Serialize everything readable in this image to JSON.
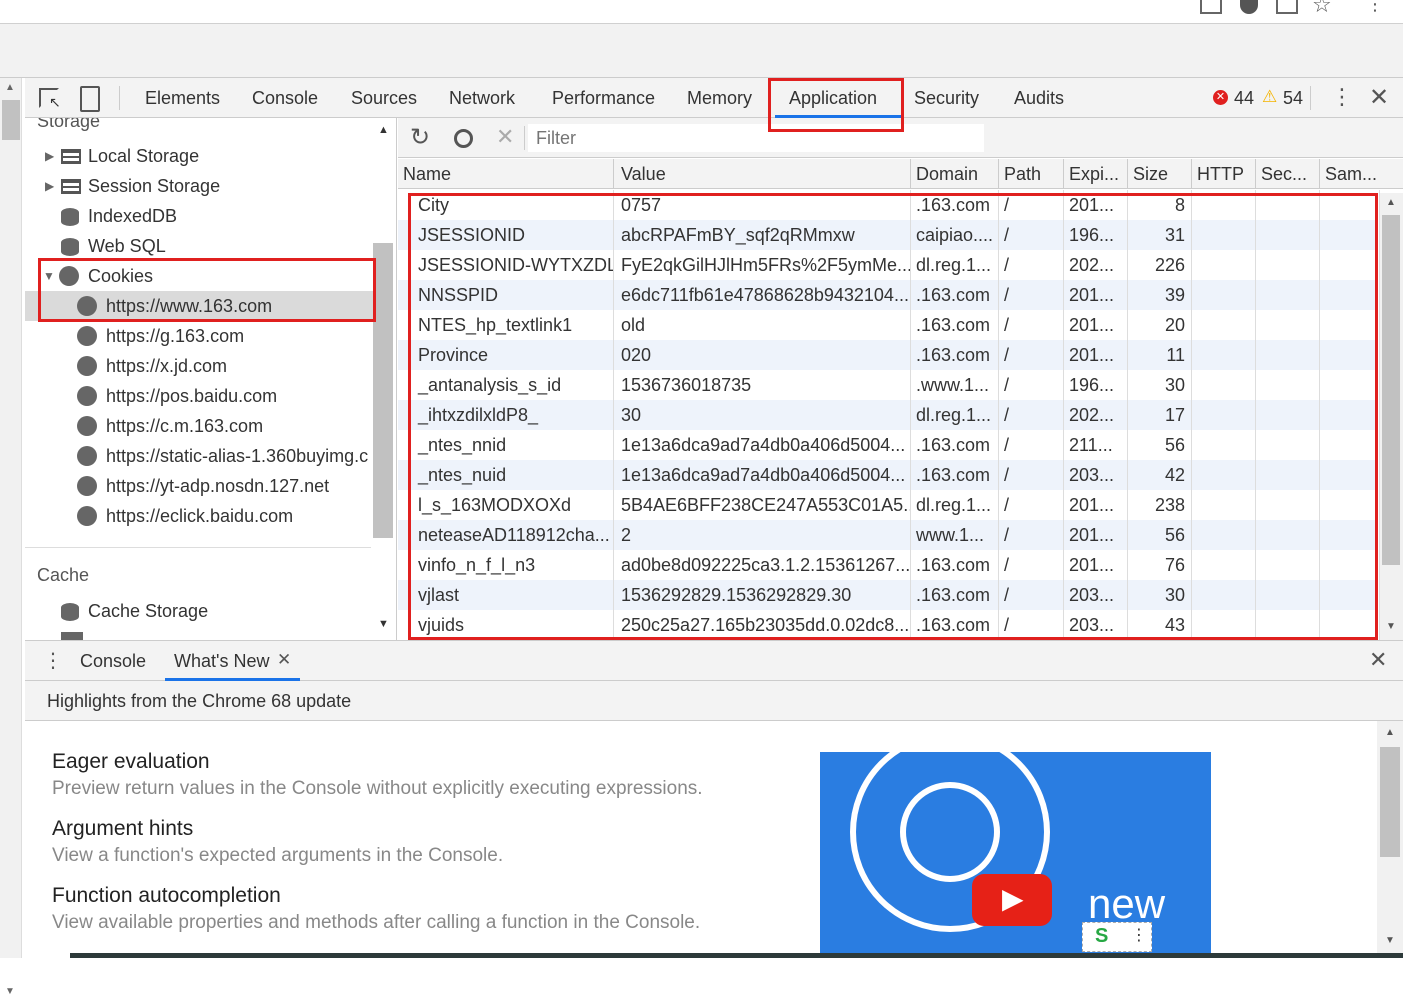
{
  "toolbar": {
    "tabs": [
      "Elements",
      "Console",
      "Sources",
      "Network",
      "Performance",
      "Memory",
      "Application",
      "Security",
      "Audits"
    ],
    "active_tab": "Application",
    "errors": "44",
    "warnings": "54"
  },
  "sidebar": {
    "section_storage": "Storage",
    "items": [
      "Local Storage",
      "Session Storage",
      "IndexedDB",
      "Web SQL",
      "Cookies"
    ],
    "cookie_origins": [
      "https://www.163.com",
      "https://g.163.com",
      "https://x.jd.com",
      "https://pos.baidu.com",
      "https://c.m.163.com",
      "https://static-alias-1.360buyimg.c",
      "https://yt-adp.nosdn.127.net",
      "https://eclick.baidu.com"
    ],
    "section_cache": "Cache",
    "cache_items": [
      "Cache Storage"
    ]
  },
  "filter": {
    "placeholder": "Filter"
  },
  "table": {
    "columns": [
      "Name",
      "Value",
      "Domain",
      "Path",
      "Expi...",
      "Size",
      "HTTP",
      "Sec...",
      "Sam..."
    ],
    "rows": [
      [
        "City",
        "0757",
        ".163.com",
        "/",
        "201...",
        "8"
      ],
      [
        "JSESSIONID",
        "abcRPAFmBY_sqf2qRMmxw",
        "caipiao....",
        "/",
        "196...",
        "31"
      ],
      [
        "JSESSIONID-WYTXZDL",
        "FyE2qkGilHJlHm5FRs%2F5ymMe...",
        "dl.reg.1...",
        "/",
        "202...",
        "226"
      ],
      [
        "NNSSPID",
        "e6dc711fb61e47868628b9432104...",
        ".163.com",
        "/",
        "201...",
        "39"
      ],
      [
        "NTES_hp_textlink1",
        "old",
        ".163.com",
        "/",
        "201...",
        "20"
      ],
      [
        "Province",
        "020",
        ".163.com",
        "/",
        "201...",
        "11"
      ],
      [
        "_antanalysis_s_id",
        "1536736018735",
        ".www.1...",
        "/",
        "196...",
        "30"
      ],
      [
        "_ihtxzdilxldP8_",
        "30",
        "dl.reg.1...",
        "/",
        "202...",
        "17"
      ],
      [
        "_ntes_nnid",
        "1e13a6dca9ad7a4db0a406d5004...",
        ".163.com",
        "/",
        "211...",
        "56"
      ],
      [
        "_ntes_nuid",
        "1e13a6dca9ad7a4db0a406d5004...",
        ".163.com",
        "/",
        "203...",
        "42"
      ],
      [
        "l_s_163MODXOXd",
        "5B4AE6BFF238CE247A553C01A5...",
        "dl.reg.1...",
        "/",
        "201...",
        "238"
      ],
      [
        "neteaseAD118912cha...",
        "2",
        "www.1...",
        "/",
        "201...",
        "56"
      ],
      [
        "vinfo_n_f_l_n3",
        "ad0be8d092225ca3.1.2.15361267...",
        ".163.com",
        "/",
        "201...",
        "76"
      ],
      [
        "vjlast",
        "1536292829.1536292829.30",
        ".163.com",
        "/",
        "203...",
        "30"
      ],
      [
        "vjuids",
        "250c25a27.165b23035dd.0.02dc8...",
        ".163.com",
        "/",
        "203...",
        "43"
      ]
    ]
  },
  "drawer": {
    "tabs": [
      "Console",
      "What's New"
    ],
    "highlights": "Highlights from the Chrome 68 update",
    "features": [
      {
        "title": "Eager evaluation",
        "desc": "Preview return values in the Console without explicitly executing expressions."
      },
      {
        "title": "Argument hints",
        "desc": "View a function's expected arguments in the Console."
      },
      {
        "title": "Function autocompletion",
        "desc": "View available properties and methods after calling a function in the Console."
      }
    ],
    "video_text": "new"
  },
  "colors": {
    "accent": "#1a73e8",
    "highlight_box": "#e0201f",
    "error": "#e0201f",
    "warning": "#f4b400"
  }
}
